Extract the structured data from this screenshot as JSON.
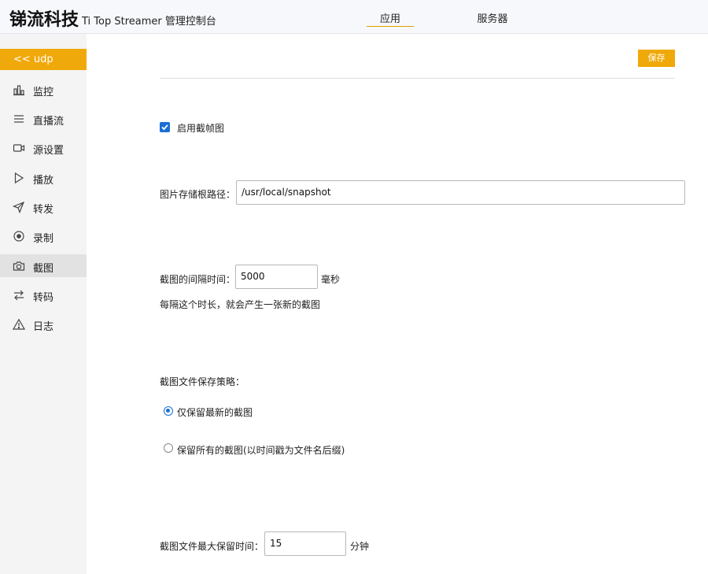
{
  "header": {
    "brand": "锑流科技",
    "subtitle": "Ti Top Streamer 管理控制台",
    "tabs": [
      {
        "label": "应用",
        "active": true
      },
      {
        "label": "服务器",
        "active": false
      }
    ]
  },
  "sidebar": {
    "back_label": "<< udp",
    "items": [
      {
        "label": "监控",
        "icon": "bar-chart-icon",
        "active": false
      },
      {
        "label": "直播流",
        "icon": "list-icon",
        "active": false
      },
      {
        "label": "源设置",
        "icon": "video-camera-icon",
        "active": false
      },
      {
        "label": "播放",
        "icon": "play-icon",
        "active": false
      },
      {
        "label": "转发",
        "icon": "send-icon",
        "active": false
      },
      {
        "label": "录制",
        "icon": "record-icon",
        "active": false
      },
      {
        "label": "截图",
        "icon": "camera-icon",
        "active": true
      },
      {
        "label": "转码",
        "icon": "swap-icon",
        "active": false
      },
      {
        "label": "日志",
        "icon": "warning-icon",
        "active": false
      }
    ]
  },
  "main": {
    "save_label": "保存",
    "enable_snapshot": {
      "label": "启用截帧图",
      "checked": true
    },
    "root_path": {
      "label": "图片存储根路径：",
      "value": "/usr/local/snapshot"
    },
    "interval": {
      "label": "截图的间隔时间：",
      "value": "5000",
      "unit": "毫秒",
      "hint": "每隔这个时长，就会产生一张新的截图"
    },
    "strategy": {
      "label": "截图文件保存策略：",
      "options": [
        {
          "label": "仅保留最新的截图",
          "selected": true
        },
        {
          "label": "保留所有的截图(以时间戳为文件名后缀)",
          "selected": false
        }
      ]
    },
    "max_retention": {
      "label": "截图文件最大保留时间：",
      "value": "15",
      "unit": "分钟"
    }
  },
  "colors": {
    "accent": "#f0a90a",
    "primary": "#1a6fd6"
  }
}
